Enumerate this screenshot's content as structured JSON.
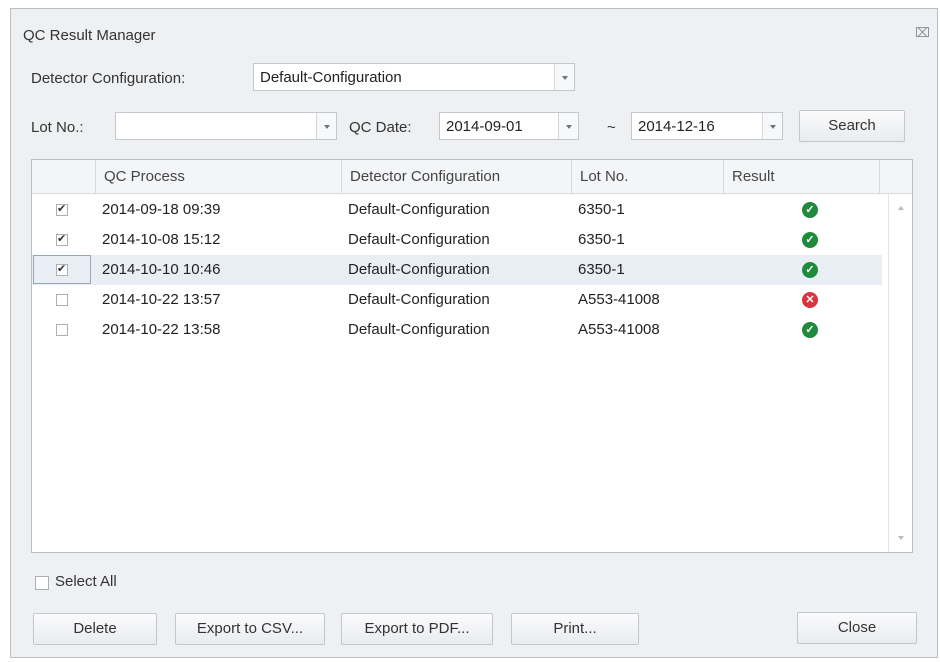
{
  "window": {
    "title": "QC Result Manager",
    "close_glyph": "⌧"
  },
  "filters": {
    "detector_config_label": "Detector Configuration:",
    "detector_config_value": "Default-Configuration",
    "lot_label": "Lot No.:",
    "lot_value": "",
    "qc_date_label": "QC Date:",
    "date_from": "2014-09-01",
    "date_sep": "~",
    "date_to": "2014-12-16",
    "search_label": "Search"
  },
  "table": {
    "columns": [
      "",
      "QC Process",
      "Detector Configuration",
      "Lot No.",
      "Result"
    ],
    "rows": [
      {
        "checked": true,
        "process": "2014-09-18 09:39",
        "config": "Default-Configuration",
        "lot": "6350-1",
        "result": "pass"
      },
      {
        "checked": true,
        "process": "2014-10-08 15:12",
        "config": "Default-Configuration",
        "lot": "6350-1",
        "result": "pass"
      },
      {
        "checked": true,
        "process": "2014-10-10 10:46",
        "config": "Default-Configuration",
        "lot": "6350-1",
        "result": "pass",
        "selected": true
      },
      {
        "checked": false,
        "process": "2014-10-22 13:57",
        "config": "Default-Configuration",
        "lot": "A553-41008",
        "result": "fail"
      },
      {
        "checked": false,
        "process": "2014-10-22 13:58",
        "config": "Default-Configuration",
        "lot": "A553-41008",
        "result": "pass"
      }
    ]
  },
  "select_all_label": "Select All",
  "buttons": {
    "delete": "Delete",
    "export_csv": "Export to CSV...",
    "export_pdf": "Export to PDF...",
    "print": "Print...",
    "close": "Close"
  },
  "icons": {
    "pass": "check-circle-icon",
    "fail": "x-circle-icon"
  },
  "colors": {
    "pass": "#1e8a3c",
    "fail": "#d9343d",
    "selection": "#e9eef5"
  }
}
